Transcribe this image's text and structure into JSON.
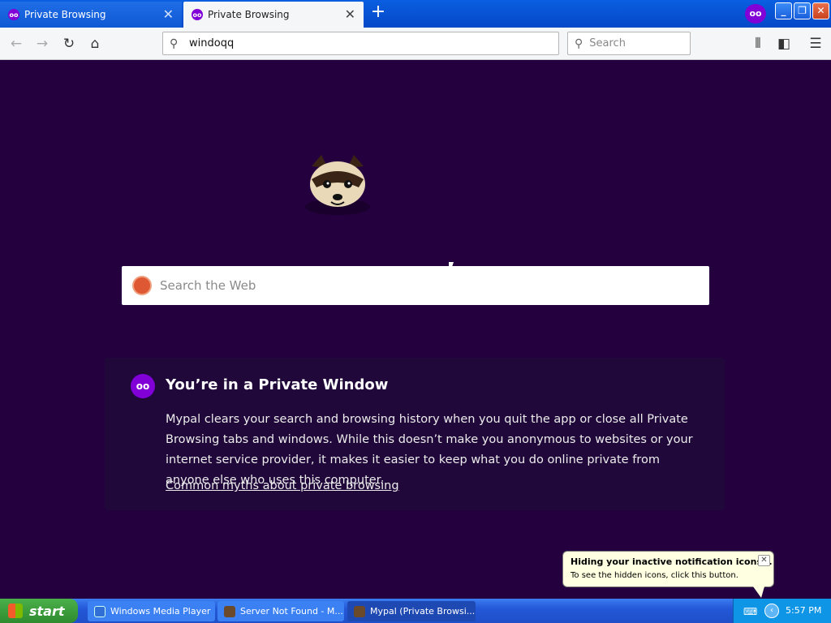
{
  "browser": {
    "tabs": [
      {
        "label": "Private Browsing",
        "active": false
      },
      {
        "label": "Private Browsing",
        "active": true
      }
    ],
    "new_tab_label": "+",
    "url_value": "windoqq",
    "search_placeholder": "Search"
  },
  "page": {
    "web_search_placeholder": "Search the Web",
    "private_title": "You’re in a Private Window",
    "private_body": "Mypal clears your search and browsing history when you quit the app or close all Private Browsing tabs and windows. While this doesn’t make you anonymous to websites or your internet service provider, it makes it easier to keep what you do online private from anyone else who uses this computer.",
    "myths_link": "Common myths about private browsing"
  },
  "notification": {
    "title": "Hiding your inactive notification icons...",
    "text": "To see the hidden icons, click this button."
  },
  "taskbar": {
    "start_label": "start",
    "tasks": [
      {
        "label": "Windows Media Player"
      },
      {
        "label": "Server Not Found - M..."
      },
      {
        "label": "Mypal (Private Browsi..."
      }
    ],
    "clock": "5:57 PM"
  },
  "colors": {
    "private_purple": "#8000d7",
    "page_bg": "#25003e",
    "titlebar_blue": "#0a5fe0",
    "taskbar_blue": "#2458d8",
    "start_green": "#2e8b2e"
  }
}
